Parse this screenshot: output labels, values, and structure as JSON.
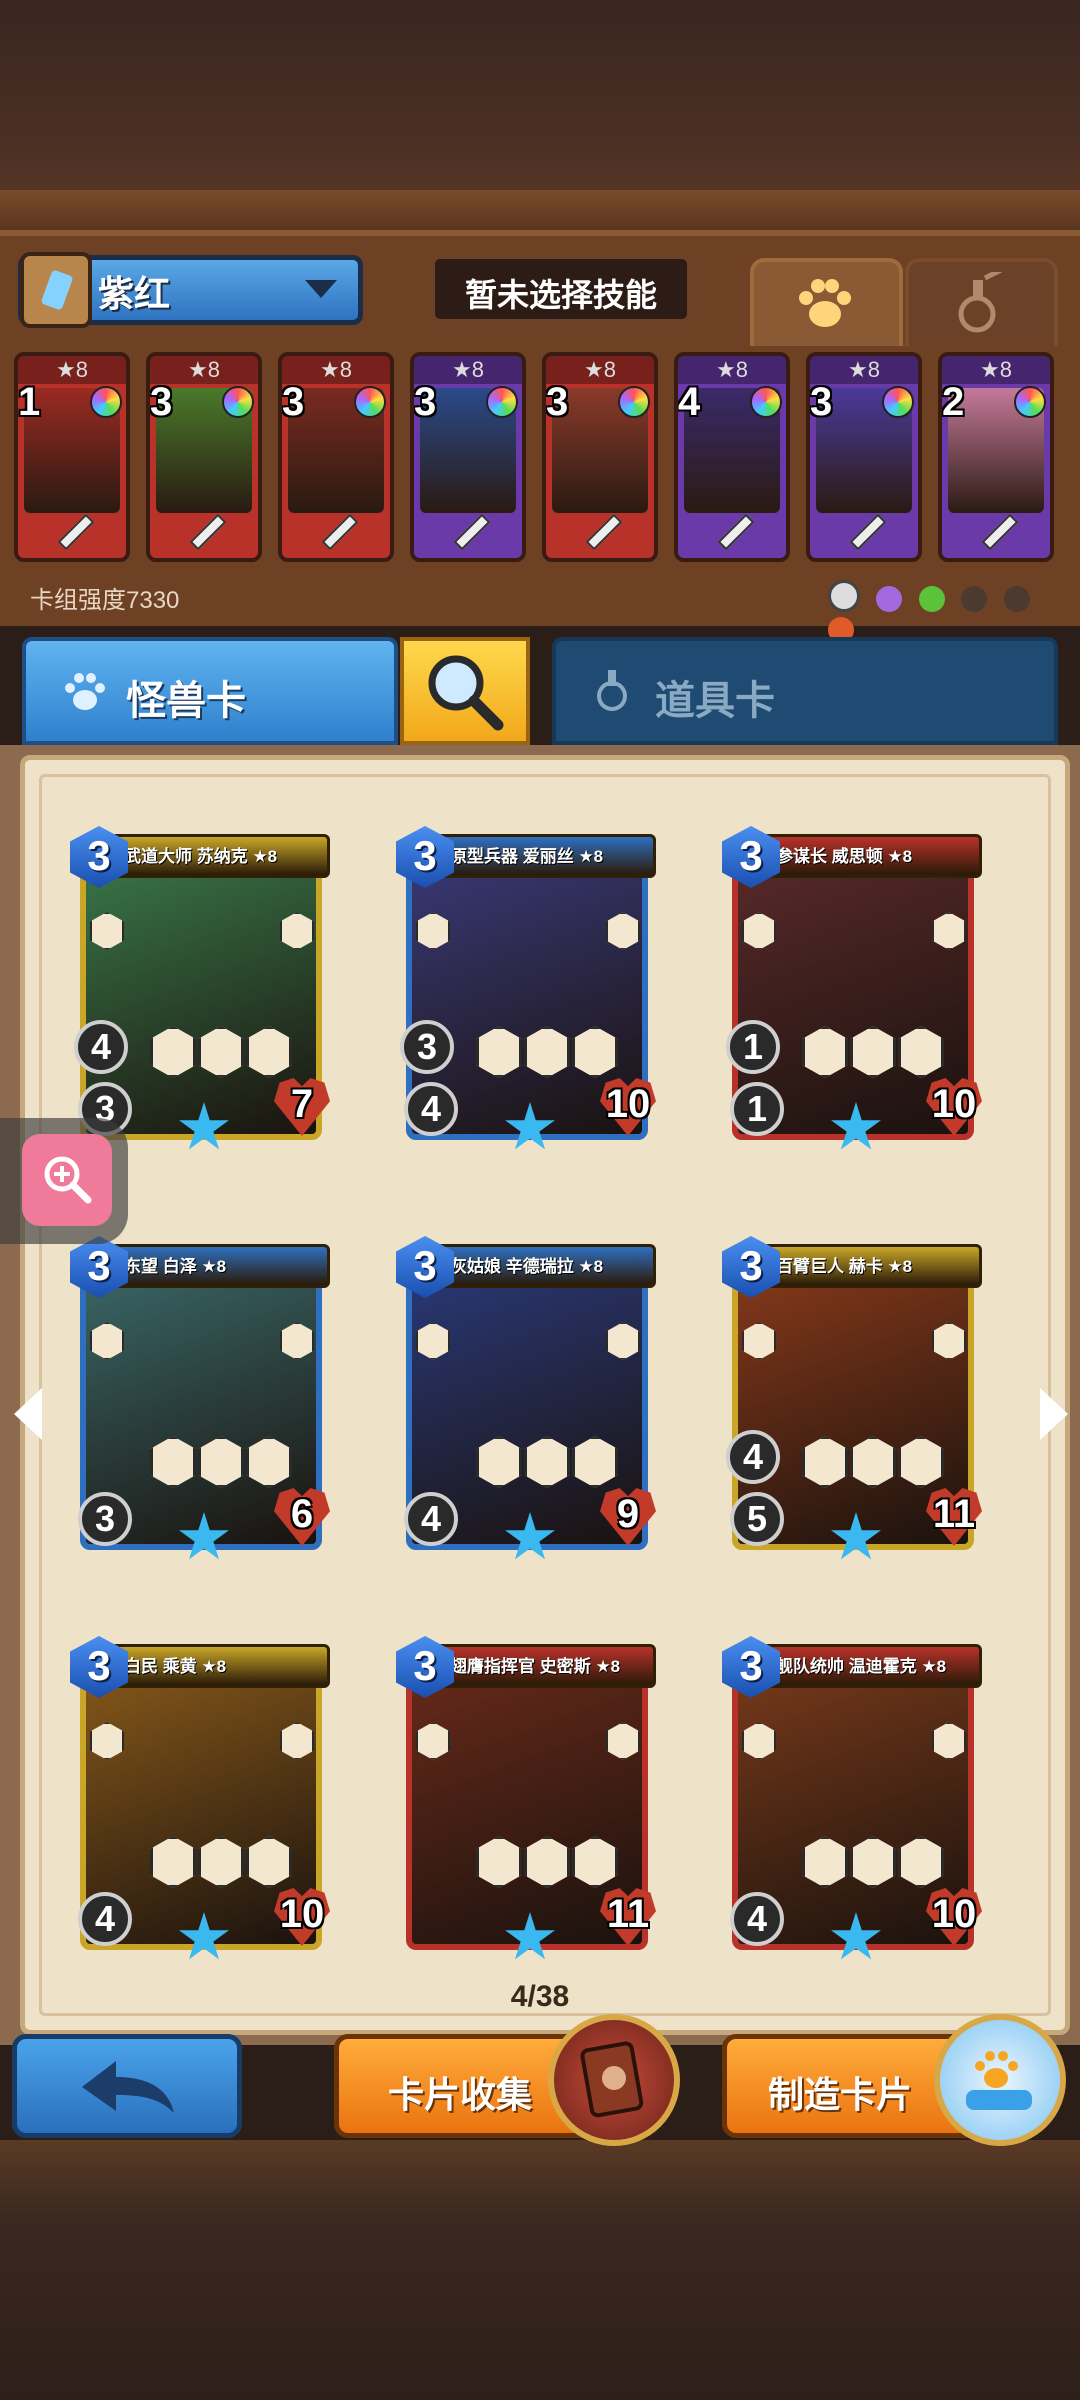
{
  "deck": {
    "name": "紫红",
    "skill_placeholder": "暂未选择技能",
    "power_label": "卡组强度7330",
    "mini_cards": [
      {
        "cost": "1",
        "stars": "★8",
        "bg": "#b8322a"
      },
      {
        "cost": "3",
        "stars": "★8",
        "bg": "#b8322a"
      },
      {
        "cost": "3",
        "stars": "★8",
        "bg": "#b8322a"
      },
      {
        "cost": "3",
        "stars": "★8",
        "bg": "#6a3aa8"
      },
      {
        "cost": "3",
        "stars": "★8",
        "bg": "#b8322a"
      },
      {
        "cost": "4",
        "stars": "★8",
        "bg": "#6a3aa8"
      },
      {
        "cost": "3",
        "stars": "★8",
        "bg": "#6a3aa8"
      },
      {
        "cost": "2",
        "stars": "★8",
        "bg": "#6a3aa8"
      }
    ]
  },
  "tabs": {
    "monster": "怪兽卡",
    "items": "道具卡"
  },
  "cards": [
    {
      "name": "武道大师 苏纳克 ★8",
      "cost": "3",
      "attack": "3",
      "hp": "7",
      "extra": "4"
    },
    {
      "name": "原型兵器 爱丽丝 ★8",
      "cost": "3",
      "attack": "4",
      "hp": "10",
      "extra": "3"
    },
    {
      "name": "参谋长 威思顿 ★8",
      "cost": "3",
      "attack": "1",
      "hp": "10",
      "extra": "1"
    },
    {
      "name": "东望 白泽 ★8",
      "cost": "3",
      "attack": "3",
      "hp": "6",
      "extra": ""
    },
    {
      "name": "灰姑娘 辛德瑞拉 ★8",
      "cost": "3",
      "attack": "4",
      "hp": "9",
      "extra": ""
    },
    {
      "name": "百臂巨人 赫卡 ★8",
      "cost": "3",
      "attack": "5",
      "hp": "11",
      "extra": "4"
    },
    {
      "name": "白民 乘黄 ★8",
      "cost": "3",
      "attack": "4",
      "hp": "10",
      "extra": ""
    },
    {
      "name": "翅膺指挥官 史密斯 ★8",
      "cost": "3",
      "attack": "",
      "hp": "11",
      "extra": ""
    },
    {
      "name": "舰队统帅 温迪霍克 ★8",
      "cost": "3",
      "attack": "4",
      "hp": "10",
      "extra": ""
    }
  ],
  "pagination": "4/38",
  "buttons": {
    "collect": "卡片收集",
    "craft": "制造卡片"
  },
  "colors": {
    "accent_blue": "#2f80cd",
    "accent_orange": "#ea7410",
    "board_bg": "#eee2c8"
  }
}
